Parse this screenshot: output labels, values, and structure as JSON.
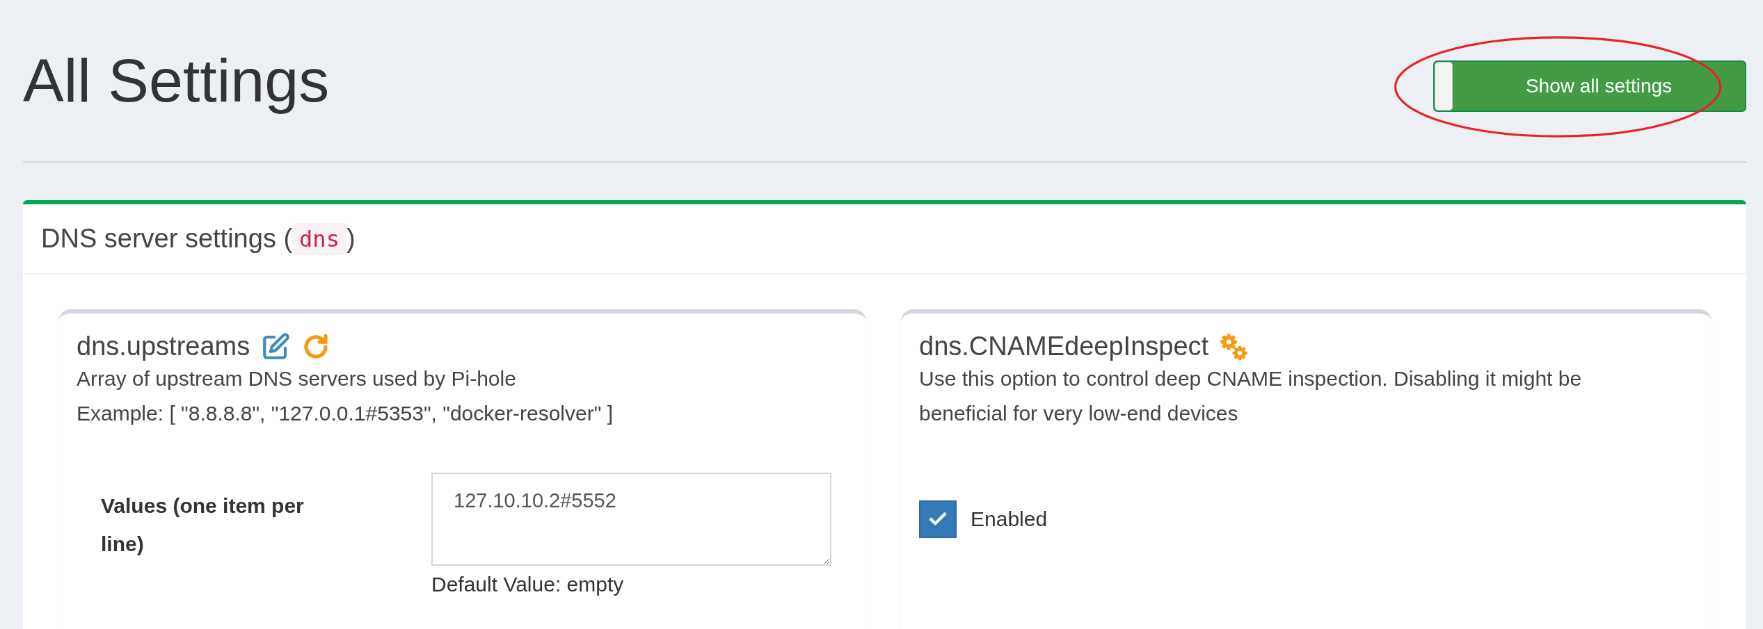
{
  "page": {
    "title": "All Settings"
  },
  "toggle": {
    "label": "Show all settings",
    "on": true
  },
  "section": {
    "title": "DNS server settings (",
    "code": "dns",
    "title_end": ")"
  },
  "settings": [
    {
      "kind": "list",
      "name": "dns.upstreams",
      "modified": true,
      "description": [
        "Array of upstream DNS servers used by Pi-hole",
        "Example: [ \"8.8.8.8\", \"127.0.0.1#5353\", \"docker-resolver\" ]"
      ],
      "field_label": "Values (one item per line)",
      "value": "127.10.10.2#5552",
      "default": "Default Value: empty"
    },
    {
      "kind": "checkbox",
      "name": "dns.CNAMEdeepInspect",
      "modified": false,
      "expert": true,
      "description": [
        "Use this option to control deep CNAME inspection. Disabling it might be beneficial for very low-end devices"
      ],
      "label": "Enabled",
      "checked": true
    }
  ]
}
